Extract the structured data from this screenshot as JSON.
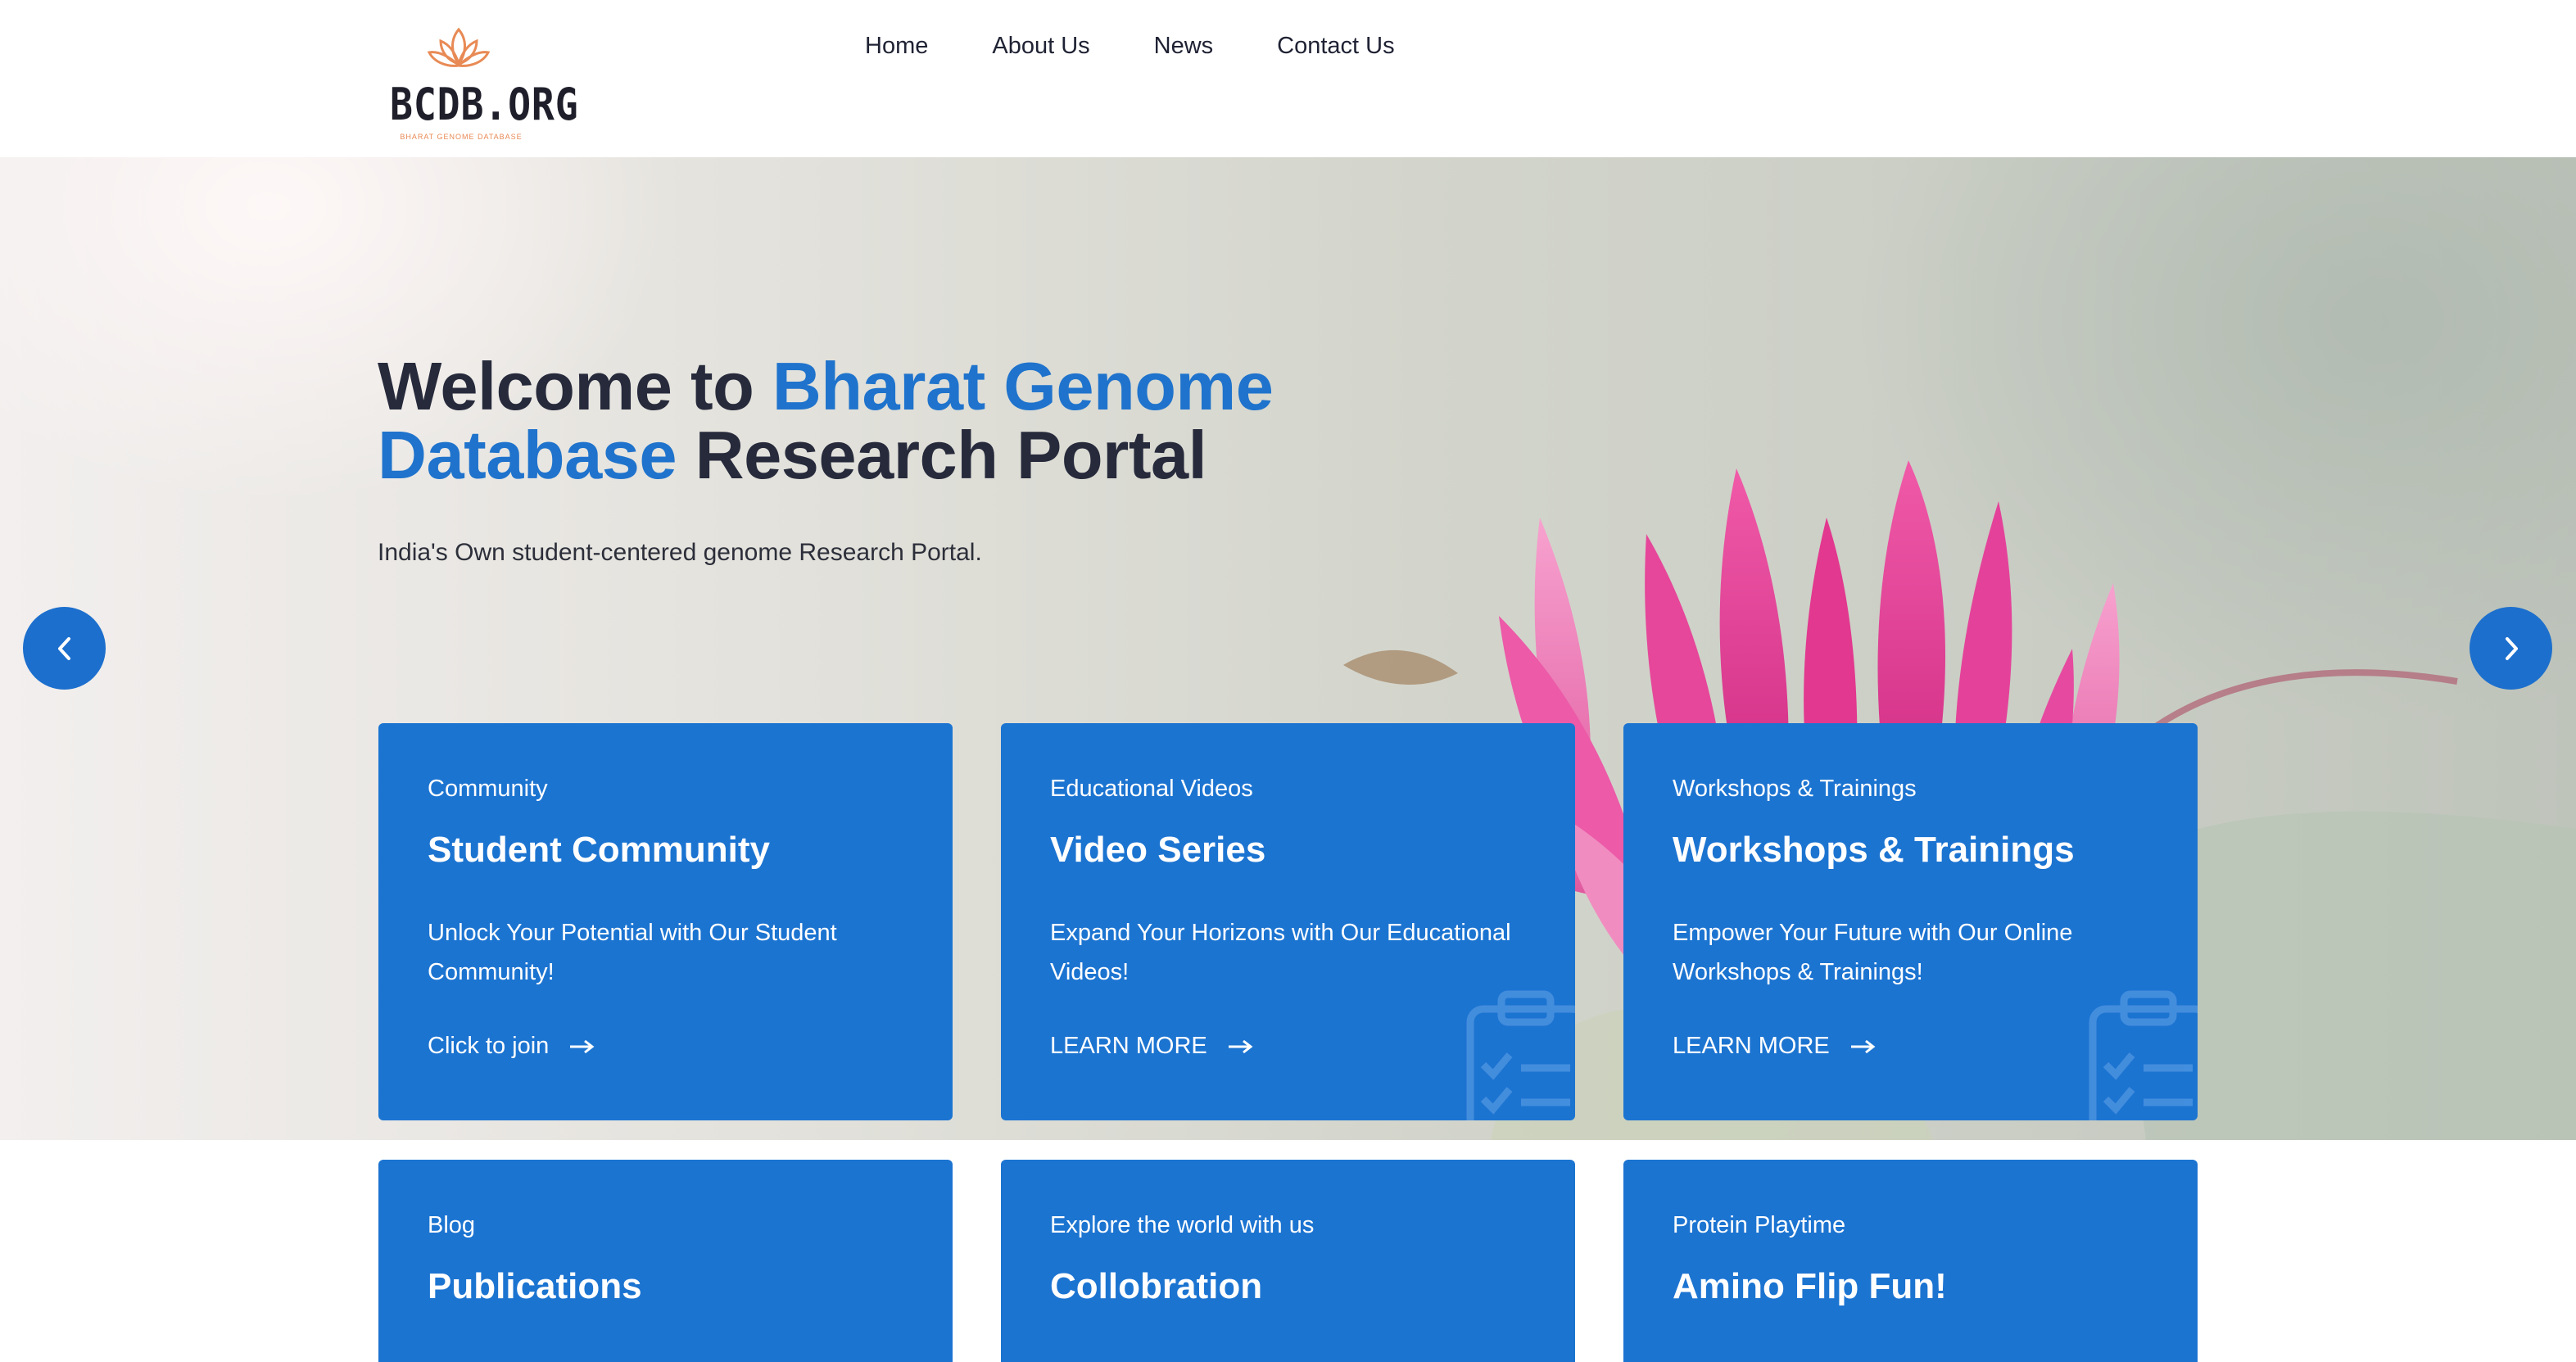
{
  "header": {
    "logo": {
      "text": "BCDB.ORG",
      "tagline": "BHARAT GENOME DATABASE",
      "icon": "lotus-icon"
    },
    "nav": [
      "Home",
      "About Us",
      "News",
      "Contact Us"
    ]
  },
  "hero": {
    "title_part1": "Welcome to ",
    "title_accent": "Bharat Genome Database",
    "title_part2": " Research Portal",
    "subtitle": "India's Own student-centered genome Research Portal.",
    "prev_icon": "chevron-left-icon",
    "next_icon": "chevron-right-icon"
  },
  "cards": [
    {
      "eyebrow": "Community",
      "title": "Student Community",
      "desc": "Unlock Your Potential with Our Student Community!",
      "cta": "Click to join"
    },
    {
      "eyebrow": "Educational Videos",
      "title": "Video Series",
      "desc": "Expand Your Horizons with Our Educational Videos!",
      "cta": "LEARN MORE"
    },
    {
      "eyebrow": "Workshops & Trainings",
      "title": "Workshops & Trainings",
      "desc": "Empower Your Future with Our Online Workshops & Trainings!",
      "cta": "LEARN MORE"
    },
    {
      "eyebrow": "Blog",
      "title": "Publications"
    },
    {
      "eyebrow": "Explore the world with us",
      "title": "Collobration"
    },
    {
      "eyebrow": "Protein Playtime",
      "title": "Amino Flip Fun!"
    }
  ],
  "colors": {
    "primary": "#1c74d1",
    "accent_text": "#1f73cc",
    "heading": "#262a3b",
    "logo_orange": "#e88a55",
    "flower_pink": "#e83d9a"
  }
}
